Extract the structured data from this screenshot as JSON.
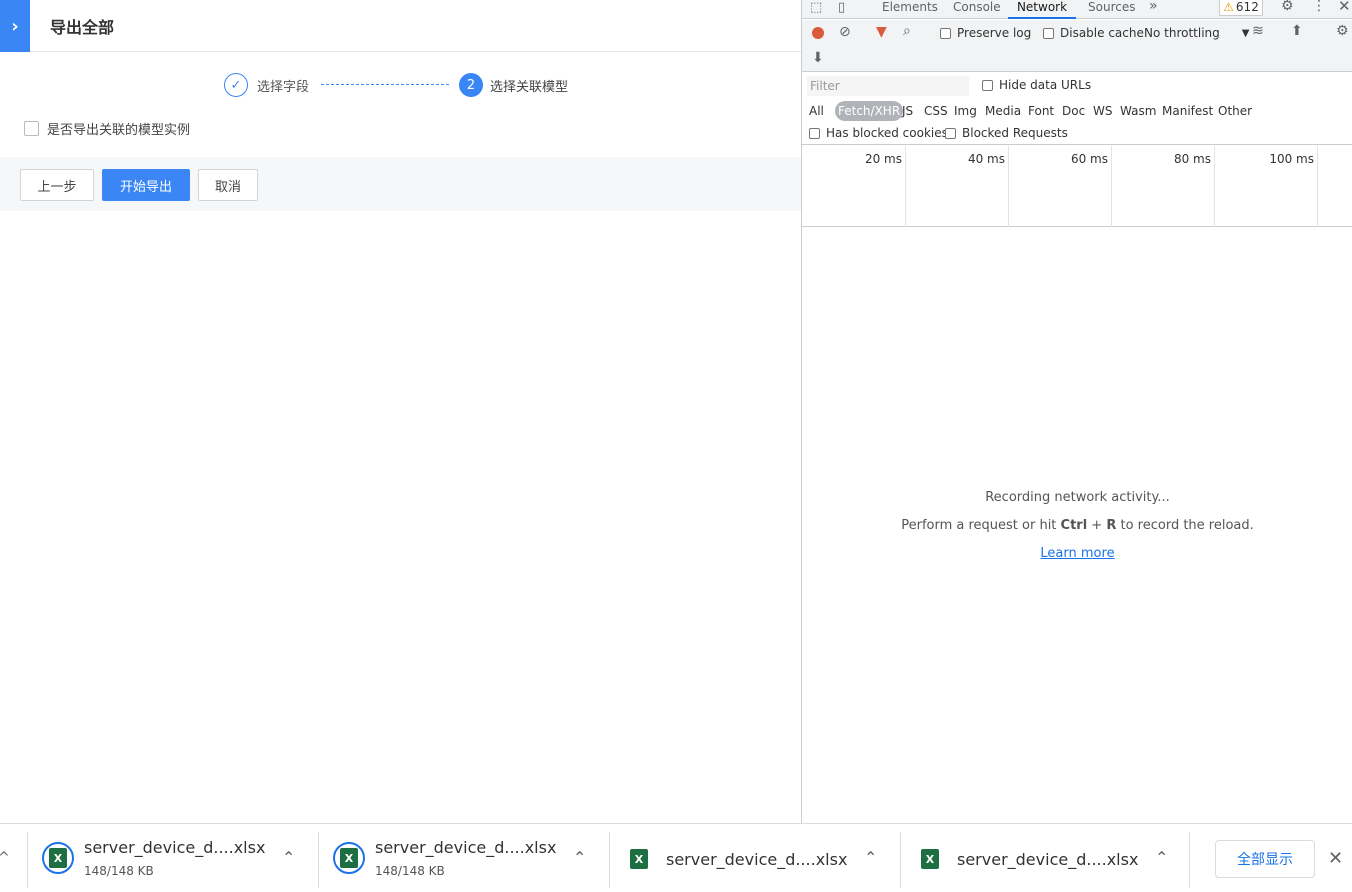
{
  "app": {
    "title": "导出全部",
    "steps": [
      {
        "label": "选择字段",
        "state": "done"
      },
      {
        "label": "选择关联模型",
        "number": "2",
        "state": "active"
      }
    ],
    "checkbox_label": "是否导出关联的模型实例",
    "buttons": {
      "prev": "上一步",
      "start": "开始导出",
      "cancel": "取消"
    },
    "accent_color": "#3a86f5"
  },
  "devtools": {
    "tabs": [
      "Elements",
      "Console",
      "Network",
      "Sources"
    ],
    "active_tab": "Network",
    "more_tabs": "»",
    "warnings_count": "612",
    "toolbar": {
      "preserve_log": "Preserve log",
      "disable_cache": "Disable cache",
      "throttling": "No throttling"
    },
    "filter": {
      "placeholder": "Filter",
      "hide_data_urls": "Hide data URLs",
      "types": [
        "All",
        "Fetch/XHR",
        "JS",
        "CSS",
        "Img",
        "Media",
        "Font",
        "Doc",
        "WS",
        "Wasm",
        "Manifest",
        "Other"
      ],
      "active_type": "Fetch/XHR",
      "has_blocked_cookies": "Has blocked cookies",
      "blocked_requests": "Blocked Requests"
    },
    "timeline_labels": [
      "20 ms",
      "40 ms",
      "60 ms",
      "80 ms",
      "100 ms"
    ],
    "empty": {
      "line1": "Recording network activity...",
      "line2_pre": "Perform a request or hit ",
      "key1": "Ctrl",
      "plus": " + ",
      "key2": "R",
      "line2_post": " to record the reload.",
      "learn_more": "Learn more"
    }
  },
  "downloads": {
    "items": [
      {
        "name": "server_device_d....xlsx",
        "size": "148/148 KB",
        "in_progress_ring": true
      },
      {
        "name": "server_device_d....xlsx",
        "size": "148/148 KB",
        "in_progress_ring": true
      },
      {
        "name": "server_device_d....xlsx",
        "size": "",
        "in_progress_ring": false
      },
      {
        "name": "server_device_d....xlsx",
        "size": "",
        "in_progress_ring": false
      }
    ],
    "show_all": "全部显示"
  }
}
